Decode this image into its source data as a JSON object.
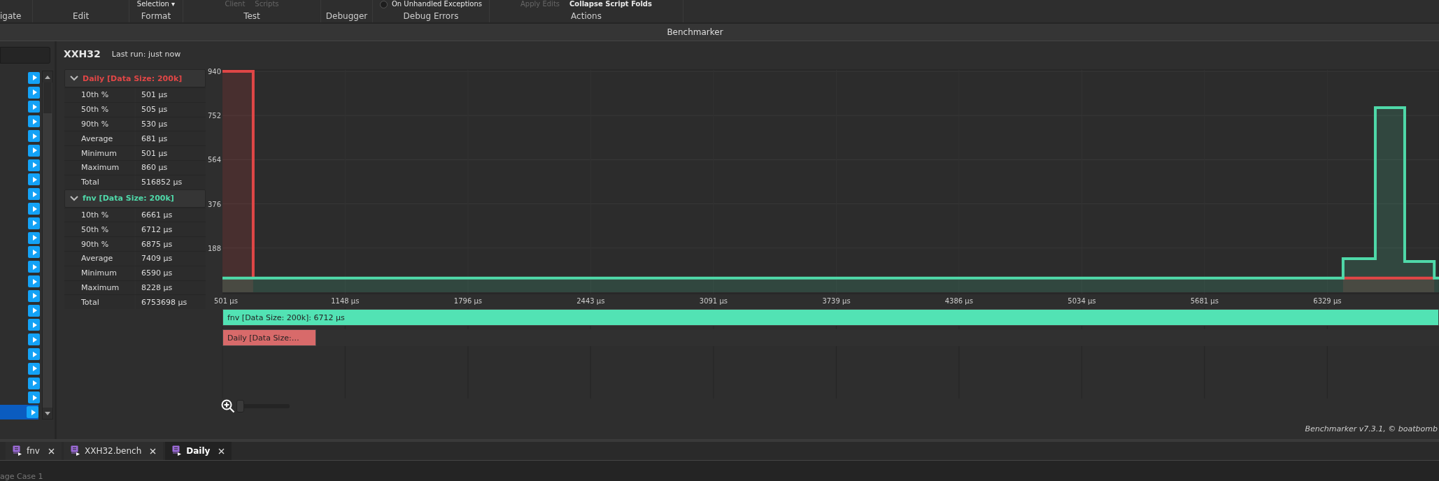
{
  "ribbon": {
    "groups": [
      {
        "label": "igate"
      },
      {
        "label": "Edit"
      },
      {
        "label": "Format",
        "items": [
          {
            "text": "Selection ▾",
            "disabled": false
          }
        ]
      },
      {
        "label": "Test",
        "items": [
          {
            "text": "Client",
            "disabled": true
          },
          {
            "text": "Scripts",
            "disabled": true
          }
        ]
      },
      {
        "label": "Debugger"
      },
      {
        "label": "Debug Errors",
        "items": [
          {
            "text": "On Unhandled Exceptions",
            "disabled": false,
            "checked": false
          }
        ]
      },
      {
        "label": "Actions",
        "items": [
          {
            "text": "Apply Edits",
            "disabled": true
          },
          {
            "text": "Collapse Script Folds",
            "disabled": false
          }
        ]
      }
    ]
  },
  "panel": {
    "title": "Benchmarker"
  },
  "list": {
    "rows": [
      {
        "selected": false
      },
      {
        "selected": false
      },
      {
        "selected": false
      },
      {
        "selected": false
      },
      {
        "selected": false
      },
      {
        "selected": false
      },
      {
        "selected": false
      },
      {
        "selected": false
      },
      {
        "selected": false
      },
      {
        "selected": false
      },
      {
        "selected": false
      },
      {
        "selected": false
      },
      {
        "selected": false
      },
      {
        "selected": false
      },
      {
        "selected": false
      },
      {
        "selected": false
      },
      {
        "selected": false
      },
      {
        "selected": false
      },
      {
        "selected": false
      },
      {
        "selected": false
      },
      {
        "selected": false
      },
      {
        "selected": false
      },
      {
        "selected": false
      },
      {
        "selected": true
      }
    ]
  },
  "benchmark": {
    "name": "XXH32",
    "last_run": "Last run: just now"
  },
  "stats": [
    {
      "title": "Daily [Data Size: 200k]",
      "color": "#e04646",
      "expanded": true,
      "rows": [
        [
          "10th %",
          "501 µs"
        ],
        [
          "50th %",
          "505 µs"
        ],
        [
          "90th %",
          "530 µs"
        ],
        [
          "Average",
          "681 µs"
        ],
        [
          "Minimum",
          "501 µs"
        ],
        [
          "Maximum",
          "860 µs"
        ],
        [
          "Total",
          "516852 µs"
        ]
      ]
    },
    {
      "title": "fnv [Data Size: 200k]",
      "color": "#4fd9a9",
      "expanded": true,
      "rows": [
        [
          "10th %",
          "6661 µs"
        ],
        [
          "50th %",
          "6712 µs"
        ],
        [
          "90th %",
          "6875 µs"
        ],
        [
          "Average",
          "7409 µs"
        ],
        [
          "Minimum",
          "6590 µs"
        ],
        [
          "Maximum",
          "8228 µs"
        ],
        [
          "Total",
          "6753698 µs"
        ]
      ]
    }
  ],
  "chart_data": {
    "type": "area",
    "grid": true,
    "x": [
      501,
      663,
      663,
      6412,
      6412,
      6582,
      6582,
      6737,
      6737,
      6893,
      6893,
      6918
    ],
    "xlim": [
      501,
      6918
    ],
    "ylim": [
      0,
      940
    ],
    "xticks": [
      {
        "value": 501,
        "label": "501 µs"
      },
      {
        "value": 1148,
        "label": "1148 µs"
      },
      {
        "value": 1796,
        "label": "1796 µs"
      },
      {
        "value": 2443,
        "label": "2443 µs"
      },
      {
        "value": 3091,
        "label": "3091 µs"
      },
      {
        "value": 3739,
        "label": "3739 µs"
      },
      {
        "value": 4386,
        "label": "4386 µs"
      },
      {
        "value": 5034,
        "label": "5034 µs"
      },
      {
        "value": 5681,
        "label": "5681 µs"
      },
      {
        "value": 6329,
        "label": "6329 µs"
      }
    ],
    "yticks": [
      188,
      376,
      564,
      752,
      940
    ],
    "series": [
      {
        "color": "#e04646",
        "values": [
          940,
          940,
          60,
          null,
          60,
          60,
          60,
          60,
          60,
          60,
          null,
          null
        ]
      },
      {
        "color": "#4fd9a9",
        "values": [
          60,
          60,
          60,
          60,
          143,
          143,
          785,
          785,
          131,
          131,
          60,
          60
        ]
      }
    ]
  },
  "bars": [
    {
      "label": "fnv [Data Size: 200k]: 6712 µs",
      "color": "#52e3b4",
      "level": 1
    },
    {
      "label": "Daily [Data Size:…",
      "color": "#d86a6a",
      "level": 0.077
    }
  ],
  "zoom": {
    "level": 0
  },
  "footer": "Benchmarker v7.3.1, © boatbomb",
  "tabs": [
    {
      "label": "fnv",
      "selected": false
    },
    {
      "label": "XXH32.bench",
      "selected": false
    },
    {
      "label": "Daily",
      "selected": true
    }
  ],
  "output": {
    "text": "age Case 1"
  }
}
